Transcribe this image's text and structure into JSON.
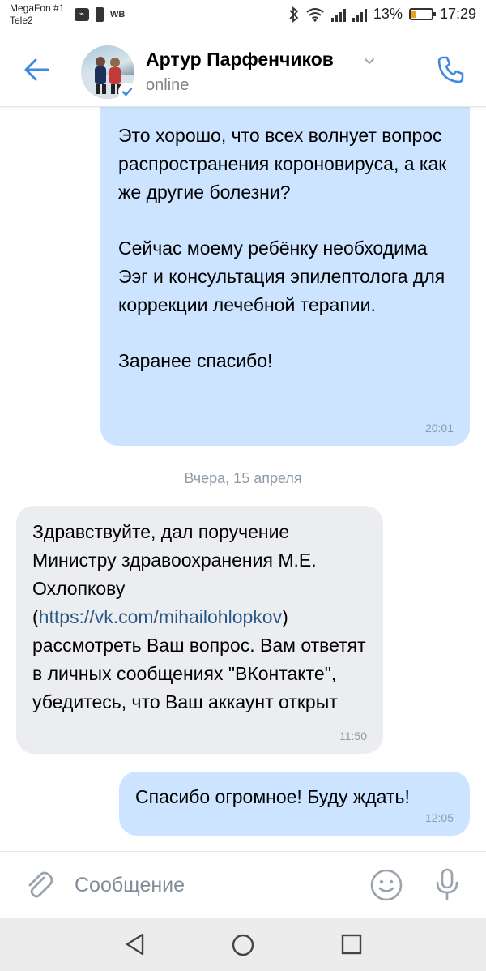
{
  "status_bar": {
    "carrier1": "MegaFon #1",
    "carrier2": "Tele2",
    "badge_left": "WB",
    "battery_percent": "13%",
    "time": "17:29"
  },
  "header": {
    "contact_name": "Артур Парфенчиков",
    "contact_status": "online"
  },
  "messages": [
    {
      "direction": "out",
      "paragraphs": [
        "Это хорошо, что всех волнует вопрос распространения короновируса, а как же другие болезни?",
        "Сейчас моему ребёнку необходима Ээг и консультация эпилептолога для коррекции лечебной терапии.",
        "Заранее спасибо!"
      ],
      "time": "20:01"
    },
    {
      "direction": "in",
      "text_before_link": "Здравствуйте, дал поручение Министру здравоохранения М.Е. Охлопкову (",
      "link": "https://vk.com/mihailohlopkov",
      "text_after_link": ") рассмотреть Ваш вопрос. Вам ответят в личных сообщениях \"ВКонтакте\", убедитесь, что Ваш аккаунт открыт",
      "time": "11:50"
    },
    {
      "direction": "out",
      "text": "Спасибо огромное! Буду ждать!",
      "time": "12:05"
    }
  ],
  "date_separator": "Вчера, 15 апреля",
  "composer": {
    "placeholder": "Сообщение"
  },
  "colors": {
    "accent": "#3f8ae0",
    "outgoing_bubble": "#cce4ff",
    "incoming_bubble": "#ebedf0",
    "link": "#2a5885"
  }
}
